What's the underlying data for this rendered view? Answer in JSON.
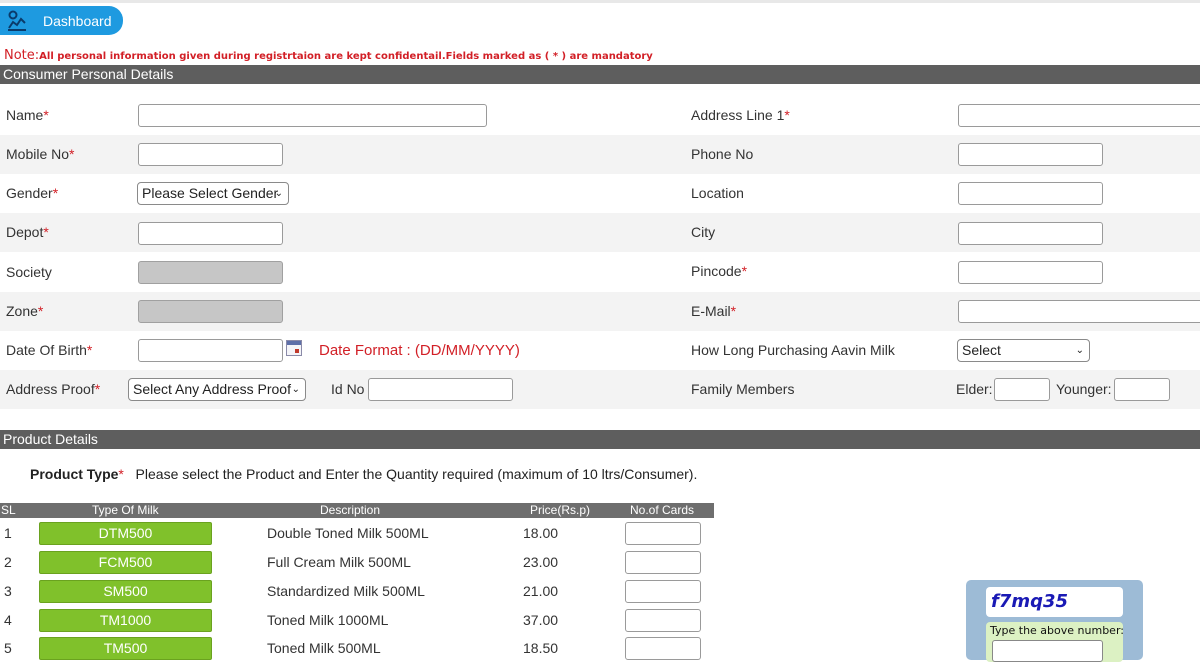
{
  "header": {
    "dashboard_label": "Dashboard"
  },
  "note": {
    "label": "Note:",
    "text": "All personal information given during registrtaion are kept confidentail.Fields marked as ( * ) are mandatory"
  },
  "sections": {
    "personal": "Consumer Personal Details",
    "product": "Product Details"
  },
  "personal_left": {
    "name": "Name",
    "mobile": "Mobile No",
    "gender": "Gender",
    "gender_select": "Please Select Gender",
    "depot": "Depot",
    "society": "Society",
    "zone": "Zone",
    "dob": "Date Of Birth",
    "date_format": "Date Format : (DD/MM/YYYY)",
    "address_proof": "Address Proof",
    "address_proof_select": "Select Any Address Proof",
    "id_no": "Id No"
  },
  "personal_right": {
    "address1": "Address Line 1",
    "phone": "Phone No",
    "location": "Location",
    "city": "City",
    "pincode": "Pincode",
    "email": "E-Mail",
    "how_long": "How Long Purchasing Aavin Milk",
    "how_long_select": "Select",
    "family": "Family Members",
    "elder": "Elder:",
    "younger": "Younger:"
  },
  "required_mark": "*",
  "product": {
    "type_label": "Product Type",
    "instruction": "Please select the Product and Enter the Quantity required (maximum of 10 ltrs/Consumer).",
    "columns": [
      "SL",
      "Type Of Milk",
      "Description",
      "Price(Rs.p)",
      "No.of Cards"
    ],
    "rows": [
      {
        "sl": "1",
        "code": "DTM500",
        "desc": "Double Toned Milk 500ML",
        "price": "18.00"
      },
      {
        "sl": "2",
        "code": "FCM500",
        "desc": "Full Cream Milk 500ML",
        "price": "23.00"
      },
      {
        "sl": "3",
        "code": "SM500",
        "desc": "Standardized Milk 500ML",
        "price": "21.00"
      },
      {
        "sl": "4",
        "code": "TM1000",
        "desc": "Toned Milk 1000ML",
        "price": "37.00"
      },
      {
        "sl": "5",
        "code": "TM500",
        "desc": "Toned Milk 500ML",
        "price": "18.50"
      }
    ]
  },
  "captcha": {
    "code": "f7mq35",
    "prompt": "Type the above number:"
  },
  "icons": {
    "dashboard": "dashboard-chart-icon",
    "calendar": "calendar-icon",
    "chevron": "chevron-down-icon"
  }
}
